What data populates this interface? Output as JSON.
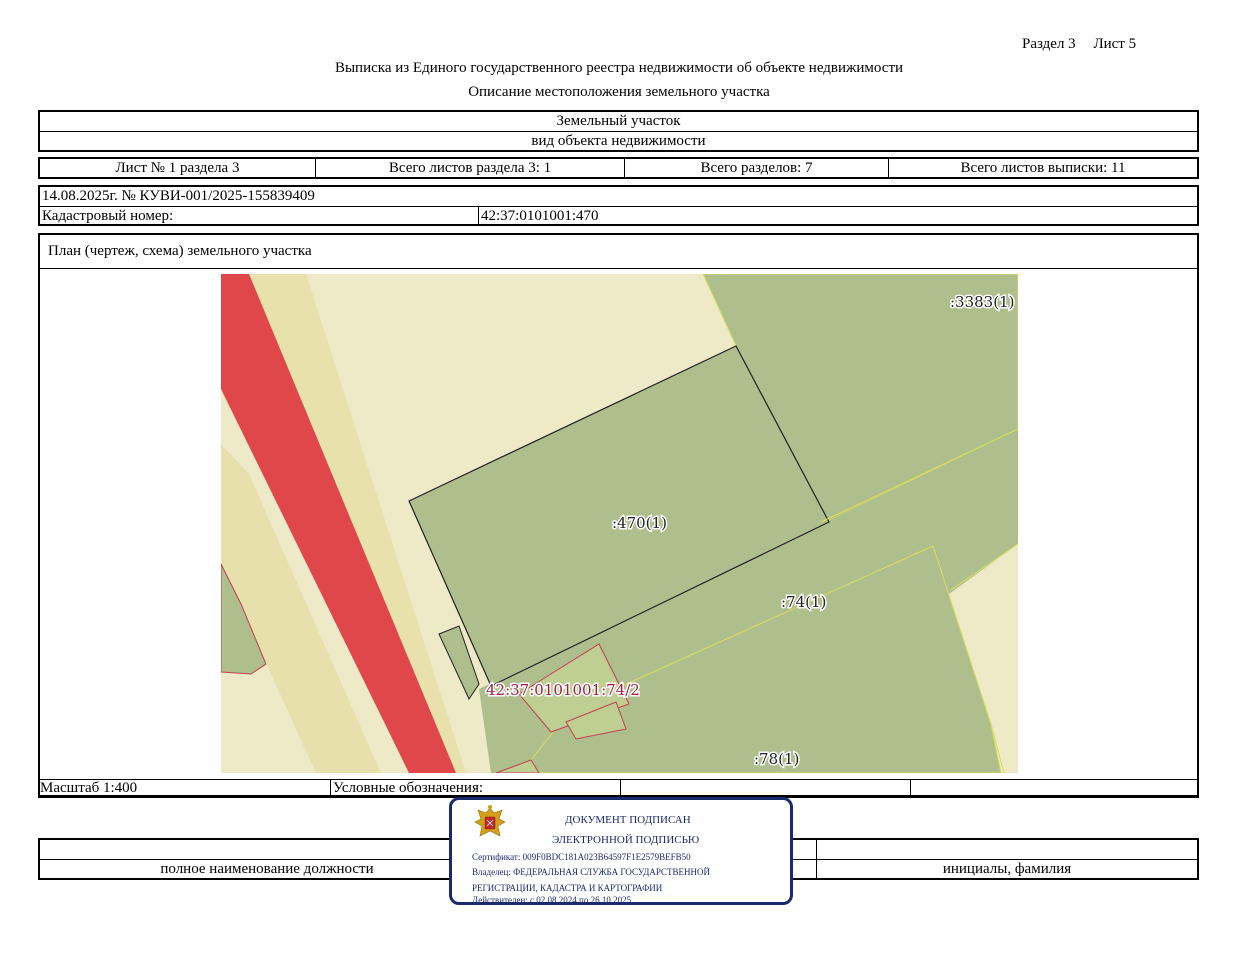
{
  "header": {
    "section": "Раздел 3",
    "sheet": "Лист 5",
    "title": "Выписка из Единого государственного реестра недвижимости об объекте недвижимости",
    "subtitle": "Описание местоположения земельного участка"
  },
  "object": {
    "name": "Земельный участок",
    "kind": "вид объекта недвижимости"
  },
  "sheets_row": {
    "sheet_of_section": "Лист № 1 раздела 3",
    "total_sheets_section": "Всего листов раздела 3: 1",
    "total_sections": "Всего разделов: 7",
    "total_sheets_extract": "Всего листов выписки: 11"
  },
  "record": {
    "date_number": "14.08.2025г. № КУВИ-001/2025-155839409",
    "cadastral_label": "Кадастровый номер:",
    "cadastral_value": "42:37:0101001:470"
  },
  "plan": {
    "title": "План (чертеж, схема) земельного участка",
    "labels": {
      "parcel_3383": ":3383(1)",
      "parcel_470": ":470(1)",
      "parcel_74": ":74(1)",
      "parcel_78": ":78(1)",
      "parcel_74_2": "42:37:0101001:74/2"
    },
    "colors": {
      "road": "#e0474a",
      "background": "#eeeac7",
      "parcel": "#afbe8d",
      "band": "#e8e1ab"
    }
  },
  "scale_row": {
    "scale": "Масштаб 1:400",
    "legend": "Условные обозначения:"
  },
  "signature_row": {
    "position": "полное наименование должности",
    "name": "инициалы, фамилия"
  },
  "stamp": {
    "line1": "ДОКУМЕНТ ПОДПИСАН",
    "line2": "ЭЛЕКТРОННОЙ ПОДПИСЬЮ",
    "certificate": "Сертификат: 009F0BDC181A023B64597F1E2579BEFB50",
    "owner1": "Владелец: ФЕДЕРАЛЬНАЯ СЛУЖБА ГОСУДАРСТВЕННОЙ",
    "owner2": "РЕГИСТРАЦИИ, КАДАСТРА И КАРТОГРАФИИ",
    "valid": "Действителен: с 02.08.2024 по 26.10.2025",
    "emblem": "eagle-emblem-icon"
  }
}
